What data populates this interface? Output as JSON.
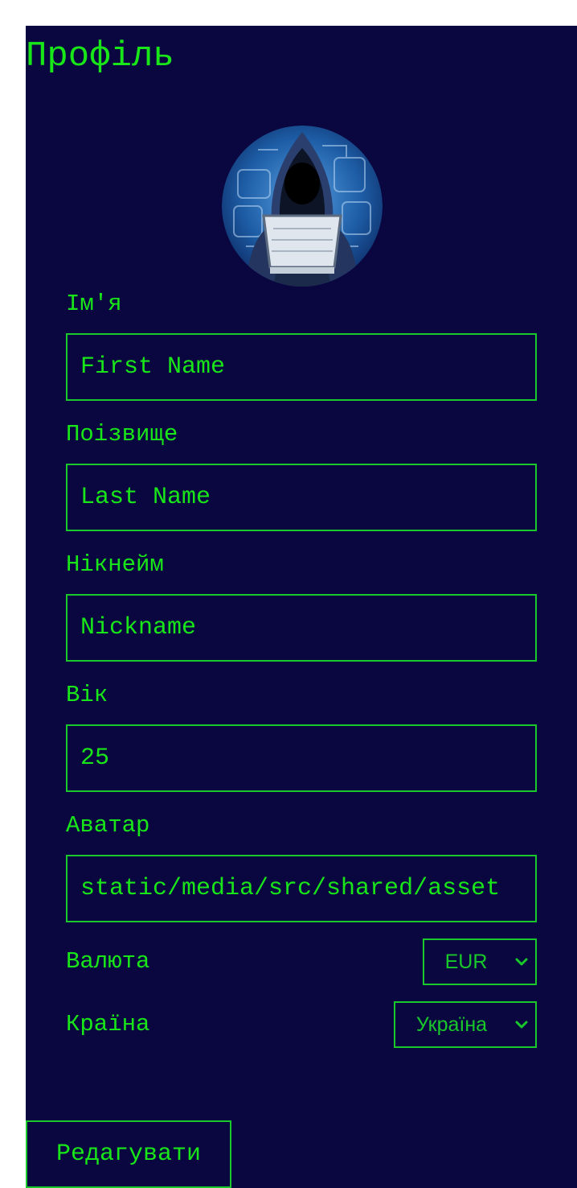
{
  "profile": {
    "title": "Профіль",
    "fields": {
      "first_name": {
        "label": "Ім'я",
        "placeholder": "First Name",
        "value": ""
      },
      "last_name": {
        "label": "Поізвище",
        "placeholder": "Last Name",
        "value": ""
      },
      "nickname": {
        "label": "Нікнейм",
        "placeholder": "Nickname",
        "value": ""
      },
      "age": {
        "label": "Вік",
        "value": "25"
      },
      "avatar": {
        "label": "Аватар",
        "value": "static/media/src/shared/asset"
      }
    },
    "currency": {
      "label": "Валюта",
      "selected": "EUR"
    },
    "country": {
      "label": "Країна",
      "selected": "Україна"
    },
    "edit_button": "Редагувати"
  },
  "colors": {
    "background": "#0a0640",
    "accent": "#19e619",
    "border": "#19c82a"
  },
  "icons": {
    "avatar": "hooded-hacker-avatar",
    "select_chevron": "chevron-down-icon"
  }
}
